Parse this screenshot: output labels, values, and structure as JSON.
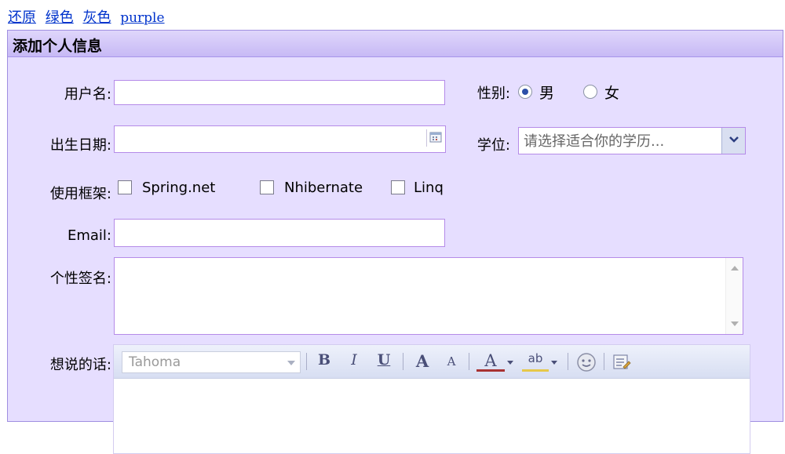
{
  "theme_links": [
    "还原",
    "绿色",
    "灰色",
    "purple"
  ],
  "panel": {
    "title": "添加个人信息"
  },
  "form": {
    "username_label": "用户名:",
    "gender_label": "性别:",
    "gender_options": [
      {
        "label": "男",
        "checked": true
      },
      {
        "label": "女",
        "checked": false
      }
    ],
    "birthdate_label": "出生日期:",
    "degree_label": "学位:",
    "degree_placeholder": "请选择适合你的学历...",
    "frameworks_label": "使用框架:",
    "frameworks": [
      {
        "label": "Spring.net",
        "checked": false
      },
      {
        "label": "Nhibernate",
        "checked": false
      },
      {
        "label": "Linq",
        "checked": false
      }
    ],
    "email_label": "Email:",
    "signature_label": "个性签名:",
    "message_label": "想说的话:"
  },
  "editor": {
    "font_value": "Tahoma",
    "buttons": {
      "bold": "B",
      "italic": "I",
      "underline": "U",
      "font_grow": "A",
      "font_shrink": "A",
      "font_color": "A",
      "highlight": "ab"
    }
  },
  "colors": {
    "panel_bg": "#e6deff",
    "border_accent": "#b58be8",
    "link": "#0033cc"
  }
}
